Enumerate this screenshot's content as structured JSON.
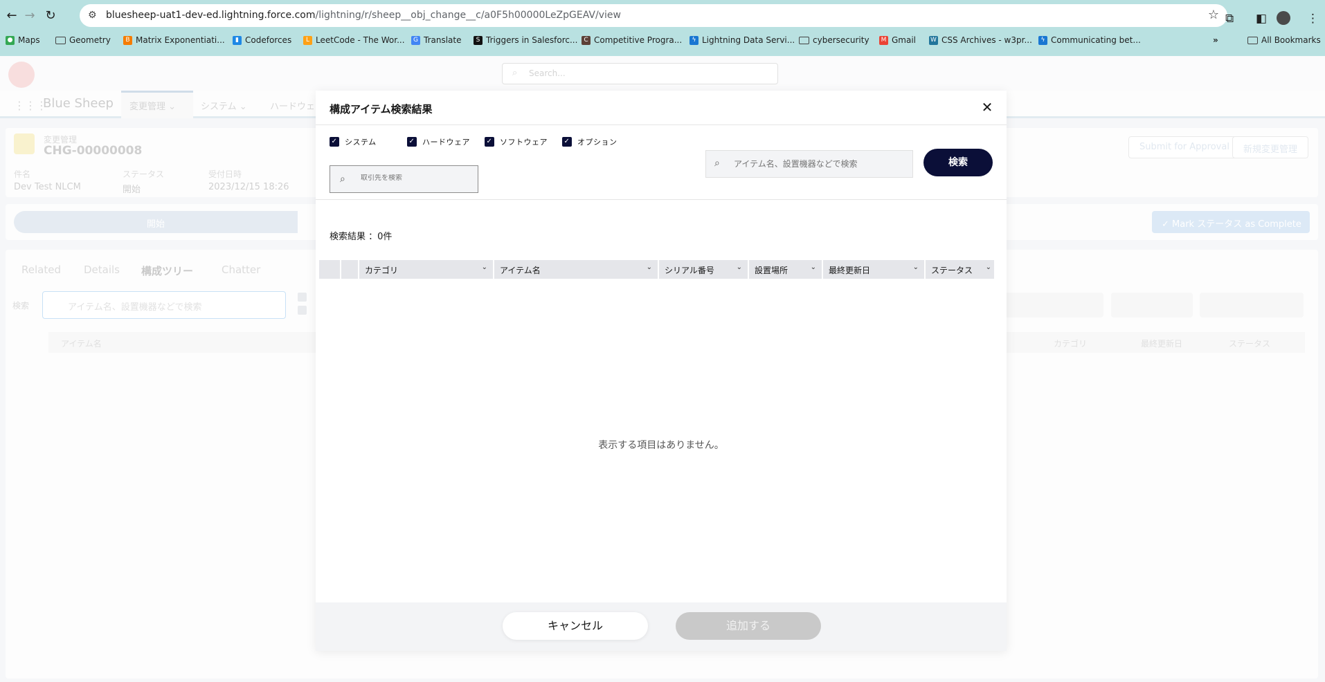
{
  "browser": {
    "url_host": "bluesheep-uat1-dev-ed.lightning.force.com",
    "url_path": "/lightning/r/sheep__obj_change__c/a0F5h00000LeZpGEAV/view",
    "bookmarks": [
      "Maps",
      "Geometry",
      "Matrix Exponentiati...",
      "Codeforces",
      "LeetCode - The Wor...",
      "Translate",
      "Triggers in Salesforc...",
      "Competitive Progra...",
      "Lightning Data Servi...",
      "cybersecurity",
      "Gmail",
      "CSS Archives - w3pr...",
      "Communicating bet..."
    ],
    "all_bookmarks": "All Bookmarks"
  },
  "sf": {
    "search_placeholder": "Search...",
    "app_name": "Blue Sheep",
    "nav_tabs": [
      "変更管理",
      "システム",
      "ハードウェ"
    ],
    "record_type": "変更管理",
    "record_name": "CHG-00000008",
    "fields": [
      {
        "label": "件名",
        "value": "Dev Test NLCM"
      },
      {
        "label": "ステータス",
        "value": "開始"
      },
      {
        "label": "受付日時",
        "value": "2023/12/15 18:26"
      }
    ],
    "buttons": [
      "Submit for Approval",
      "新規変更管理"
    ],
    "path_step": "開始",
    "mark_complete": "Mark ステータス as Complete",
    "sub_tabs": [
      "Related",
      "Details",
      "構成ツリー",
      "Chatter"
    ],
    "tree_search_label": "検索",
    "tree_search_placeholder": "アイテム名、設置機器などで検索",
    "tree_columns": [
      "アイテム名",
      "カテゴリ",
      "最終更新日",
      "ステータス"
    ]
  },
  "modal": {
    "title": "構成アイテム検索結果",
    "checkboxes": [
      "システム",
      "ハードウェア",
      "ソフトウェア",
      "オプション"
    ],
    "account_search_placeholder": "取引先を検索",
    "item_search_placeholder": "アイテム名、設置機器などで検索",
    "search_button": "検索",
    "result_count": "検索結果 ：0件",
    "columns": [
      "カテゴリ",
      "アイテム名",
      "シリアル番号",
      "設置場所",
      "最終更新日",
      "ステータス"
    ],
    "empty_message": "表示する項目はありません。",
    "cancel_button": "キャンセル",
    "add_button": "追加する"
  },
  "colors": {
    "primary": "#0b0f38",
    "disabled": "#c9c9c9",
    "browser_chrome": "#b9e1e1"
  }
}
